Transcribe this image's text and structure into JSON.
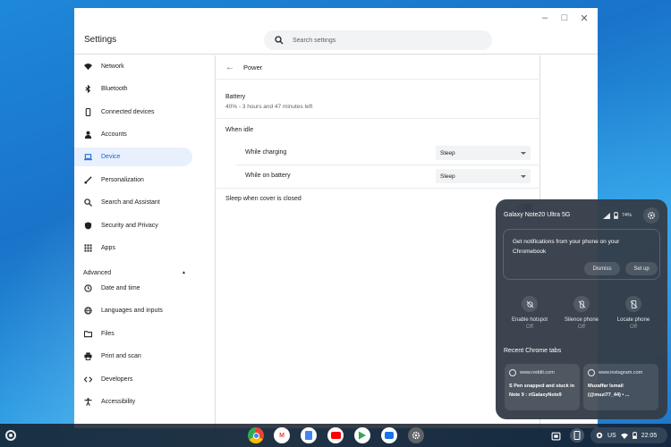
{
  "window": {
    "title": "Settings",
    "controls": [
      "–",
      "□",
      "✕"
    ]
  },
  "search": {
    "placeholder": "Search settings"
  },
  "sidebar": {
    "items": [
      {
        "label": "Network",
        "icon": "wifi-icon"
      },
      {
        "label": "Bluetooth",
        "icon": "bluetooth-icon"
      },
      {
        "label": "Connected devices",
        "icon": "phone-icon"
      },
      {
        "label": "Accounts",
        "icon": "person-icon"
      },
      {
        "label": "Device",
        "icon": "laptop-icon",
        "active": true
      },
      {
        "label": "Personalization",
        "icon": "brush-icon"
      },
      {
        "label": "Search and Assistant",
        "icon": "search-icon"
      },
      {
        "label": "Security and Privacy",
        "icon": "shield-icon"
      },
      {
        "label": "Apps",
        "icon": "grid-icon"
      }
    ],
    "advanced_label": "Advanced",
    "advanced_items": [
      {
        "label": "Date and time",
        "icon": "clock-icon"
      },
      {
        "label": "Languages and inputs",
        "icon": "globe-icon"
      },
      {
        "label": "Files",
        "icon": "folder-icon"
      },
      {
        "label": "Print and scan",
        "icon": "printer-icon"
      },
      {
        "label": "Developers",
        "icon": "code-icon"
      },
      {
        "label": "Accessibility",
        "icon": "accessibility-icon"
      }
    ]
  },
  "power": {
    "page_title": "Power",
    "battery_label": "Battery",
    "battery_status": "40% - 3 hours and 47 minutes left",
    "when_idle_label": "When idle",
    "while_charging_label": "While charging",
    "while_charging_value": "Sleep",
    "while_on_battery_label": "While on battery",
    "while_on_battery_value": "Sleep",
    "sleep_cover_label": "Sleep when cover is closed",
    "sleep_cover_enabled": true
  },
  "phone_hub": {
    "device_name": "Galaxy Note20 Ultra 5G",
    "battery": "74%",
    "notification_prompt": "Get notifications from your phone on your Chromebook",
    "dismiss_label": "Dismiss",
    "setup_label": "Set up",
    "toggles": [
      {
        "label": "Enable hotspot",
        "state": "Off",
        "icon": "hotspot-off-icon"
      },
      {
        "label": "Silence phone",
        "state": "Off",
        "icon": "silence-off-icon"
      },
      {
        "label": "Locate phone",
        "state": "Off",
        "icon": "locate-off-icon"
      }
    ],
    "recent_tabs_label": "Recent Chrome tabs",
    "tabs": [
      {
        "domain": "www.reddit.com",
        "title": "S Pen snapped and stuck in Note 9 : r/GalaxyNote9"
      },
      {
        "domain": "www.instagram.com",
        "title": "Muzaffar Ismail (@muzi77_44) • ..."
      }
    ]
  },
  "shelf": {
    "apps": [
      {
        "name": "chrome-icon",
        "color": "#ea4335"
      },
      {
        "name": "gmail-icon",
        "color": "#ffffff"
      },
      {
        "name": "docs-icon",
        "color": "#4285f4"
      },
      {
        "name": "youtube-icon",
        "color": "#ff0000"
      },
      {
        "name": "play-store-icon",
        "color": "#34a853"
      },
      {
        "name": "messages-icon",
        "color": "#1a73e8"
      },
      {
        "name": "settings-icon",
        "color": "#5f6368"
      }
    ],
    "locale": "US",
    "time": "22:05"
  },
  "colors": {
    "accent": "#1a73e8",
    "active_bg": "#e8f0fe"
  }
}
